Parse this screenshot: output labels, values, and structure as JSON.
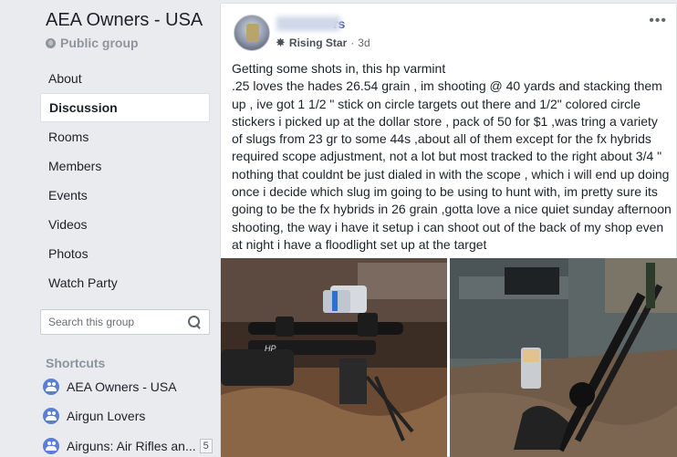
{
  "sidebar": {
    "group_name": "AEA Owners - USA",
    "group_privacy": "Public group",
    "nav": [
      {
        "label": "About"
      },
      {
        "label": "Discussion"
      },
      {
        "label": "Rooms"
      },
      {
        "label": "Members"
      },
      {
        "label": "Events"
      },
      {
        "label": "Videos"
      },
      {
        "label": "Photos"
      },
      {
        "label": "Watch Party"
      }
    ],
    "active_nav": "Discussion",
    "search_placeholder": "Search this group",
    "shortcuts_heading": "Shortcuts",
    "shortcuts": [
      {
        "label": "AEA Owners - USA",
        "icon": "group-icon"
      },
      {
        "label": "Airgun Lovers",
        "icon": "group-icon"
      },
      {
        "label": "Airguns: Air Rifles an...",
        "badge": "5",
        "icon": "group-icon"
      }
    ]
  },
  "post": {
    "author_visible": "rs",
    "badge": "Rising Star",
    "time": "3d",
    "more_icon": "ellipsis-icon",
    "text": "Getting some shots in, this hp varmint\n.25 loves the hades 26.54 grain , im shooting @ 40 yards and stacking them up , ive got 1 1/2 \" stick on circle targets out there and 1/2\" colored circle stickers i picked up at the dollar store , pack of 50 for $1 ,was tring a variety of slugs from 23 gr to some 44s ,about all of them except for the fx hybrids required scope adjustment, not a lot but most tracked to the right about 3/4 \" nothing that couldnt be just dialed in with the scope , which i will end up doing once i decide which slug im going to be using to hunt with, im pretty sure its going to be the fx hybrids in 26 grain ,gotta love a nice quiet sunday afternoon shooting, the way i have it setup i can shoot out of the back of my shop even at night i have a floodlight set up at the target",
    "photos": [
      {
        "name": "rifle-photo-left",
        "logo_text": "HP"
      },
      {
        "name": "rifle-photo-right"
      }
    ]
  }
}
